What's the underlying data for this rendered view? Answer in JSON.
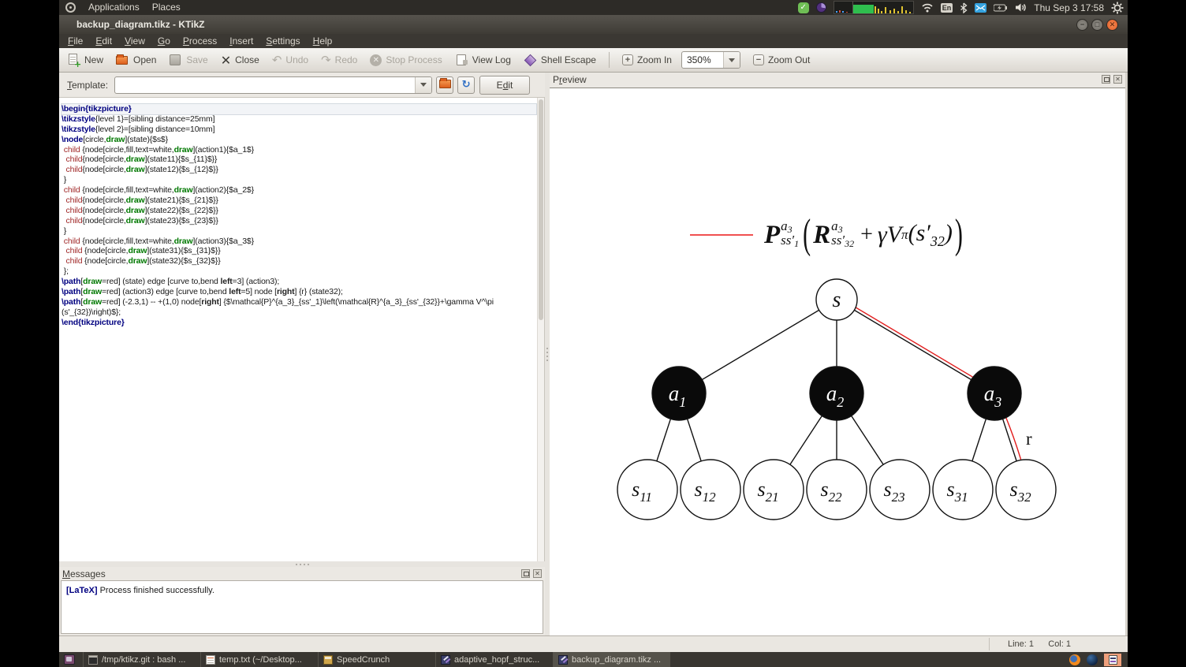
{
  "panel": {
    "menus": [
      {
        "label": "Applications"
      },
      {
        "label": "Places"
      }
    ],
    "keyboard_layout": "En",
    "clock": "Thu Sep 3 17:58"
  },
  "window": {
    "title": "backup_diagram.tikz - KTikZ"
  },
  "menubar": {
    "items": [
      {
        "label": "File"
      },
      {
        "label": "Edit"
      },
      {
        "label": "View"
      },
      {
        "label": "Go"
      },
      {
        "label": "Process"
      },
      {
        "label": "Insert"
      },
      {
        "label": "Settings"
      },
      {
        "label": "Help"
      }
    ]
  },
  "toolbar": {
    "buttons": [
      {
        "label": "New",
        "enabled": true
      },
      {
        "label": "Open",
        "enabled": true
      },
      {
        "label": "Save",
        "enabled": false
      },
      {
        "label": "Close",
        "enabled": true
      },
      {
        "label": "Undo",
        "enabled": false
      },
      {
        "label": "Redo",
        "enabled": false
      },
      {
        "label": "Stop Process",
        "enabled": false
      },
      {
        "label": "View Log",
        "enabled": true
      },
      {
        "label": "Shell Escape",
        "enabled": true
      },
      {
        "label": "Zoom In",
        "enabled": true
      },
      {
        "label": "Zoom Out",
        "enabled": true
      }
    ],
    "zoom_level": "350%"
  },
  "template_bar": {
    "label": "Template:",
    "value": "",
    "edit_button": "Edit"
  },
  "editor": {
    "current_line": 0,
    "lines": [
      {
        "seg": [
          {
            "t": "\\begin{tikzpicture}",
            "c": "k"
          }
        ]
      },
      {
        "seg": [
          {
            "t": "\\tikzstyle",
            "c": "k"
          },
          {
            "t": "{level 1}=[sibling distance=25mm]",
            "c": "p"
          }
        ]
      },
      {
        "seg": [
          {
            "t": "\\tikzstyle",
            "c": "k"
          },
          {
            "t": "{level 2}=[sibling distance=10mm]",
            "c": "p"
          }
        ]
      },
      {
        "seg": [
          {
            "t": "\\node",
            "c": "k"
          },
          {
            "t": "[circle,",
            "c": "p"
          },
          {
            "t": "draw",
            "c": "g"
          },
          {
            "t": "](state){$s$}",
            "c": "p"
          }
        ]
      },
      {
        "seg": [
          {
            "t": " ",
            "c": "p"
          },
          {
            "t": "child",
            "c": "c"
          },
          {
            "t": " {node[circle,fill,text=white,",
            "c": "p"
          },
          {
            "t": "draw",
            "c": "g"
          },
          {
            "t": "](action1){$a_1$}",
            "c": "p"
          }
        ]
      },
      {
        "seg": [
          {
            "t": "  ",
            "c": "p"
          },
          {
            "t": "child",
            "c": "c"
          },
          {
            "t": "{node[circle,",
            "c": "p"
          },
          {
            "t": "draw",
            "c": "g"
          },
          {
            "t": "](state11){$s_{11}$}}",
            "c": "p"
          }
        ]
      },
      {
        "seg": [
          {
            "t": "  ",
            "c": "p"
          },
          {
            "t": "child",
            "c": "c"
          },
          {
            "t": "{node[circle,",
            "c": "p"
          },
          {
            "t": "draw",
            "c": "g"
          },
          {
            "t": "](state12){$s_{12}$}}",
            "c": "p"
          }
        ]
      },
      {
        "seg": [
          {
            "t": " }",
            "c": "p"
          }
        ]
      },
      {
        "seg": [
          {
            "t": " ",
            "c": "p"
          },
          {
            "t": "child",
            "c": "c"
          },
          {
            "t": " {node[circle,fill,text=white,",
            "c": "p"
          },
          {
            "t": "draw",
            "c": "g"
          },
          {
            "t": "](action2){$a_2$}",
            "c": "p"
          }
        ]
      },
      {
        "seg": [
          {
            "t": "  ",
            "c": "p"
          },
          {
            "t": "child",
            "c": "c"
          },
          {
            "t": "{node[circle,",
            "c": "p"
          },
          {
            "t": "draw",
            "c": "g"
          },
          {
            "t": "](state21){$s_{21}$}}",
            "c": "p"
          }
        ]
      },
      {
        "seg": [
          {
            "t": "  ",
            "c": "p"
          },
          {
            "t": "child",
            "c": "c"
          },
          {
            "t": "{node[circle,",
            "c": "p"
          },
          {
            "t": "draw",
            "c": "g"
          },
          {
            "t": "](state22){$s_{22}$}}",
            "c": "p"
          }
        ]
      },
      {
        "seg": [
          {
            "t": "  ",
            "c": "p"
          },
          {
            "t": "child",
            "c": "c"
          },
          {
            "t": "{node[circle,",
            "c": "p"
          },
          {
            "t": "draw",
            "c": "g"
          },
          {
            "t": "](state23){$s_{23}$}}",
            "c": "p"
          }
        ]
      },
      {
        "seg": [
          {
            "t": " }",
            "c": "p"
          }
        ]
      },
      {
        "seg": [
          {
            "t": " ",
            "c": "p"
          },
          {
            "t": "child",
            "c": "c"
          },
          {
            "t": " {node[circle,fill,text=white,",
            "c": "p"
          },
          {
            "t": "draw",
            "c": "g"
          },
          {
            "t": "](action3){$a_3$}",
            "c": "p"
          }
        ]
      },
      {
        "seg": [
          {
            "t": "  ",
            "c": "p"
          },
          {
            "t": "child",
            "c": "c"
          },
          {
            "t": " {node[circle,",
            "c": "p"
          },
          {
            "t": "draw",
            "c": "g"
          },
          {
            "t": "](state31){$s_{31}$}}",
            "c": "p"
          }
        ]
      },
      {
        "seg": [
          {
            "t": "  ",
            "c": "p"
          },
          {
            "t": "child",
            "c": "c"
          },
          {
            "t": " {node[circle,",
            "c": "p"
          },
          {
            "t": "draw",
            "c": "g"
          },
          {
            "t": "](state32){$s_{32}$}}",
            "c": "p"
          }
        ]
      },
      {
        "seg": [
          {
            "t": " };",
            "c": "p"
          }
        ]
      },
      {
        "seg": [
          {
            "t": "\\path",
            "c": "k"
          },
          {
            "t": "[",
            "c": "p"
          },
          {
            "t": "draw",
            "c": "g"
          },
          {
            "t": "=red] (state) edge [curve to,bend ",
            "c": "p"
          },
          {
            "t": "left",
            "c": "o"
          },
          {
            "t": "=3] (action3);",
            "c": "p"
          }
        ]
      },
      {
        "seg": [
          {
            "t": "\\path",
            "c": "k"
          },
          {
            "t": "[",
            "c": "p"
          },
          {
            "t": "draw",
            "c": "g"
          },
          {
            "t": "=red] (action3) edge [curve to,bend ",
            "c": "p"
          },
          {
            "t": "left",
            "c": "o"
          },
          {
            "t": "=5] node [",
            "c": "p"
          },
          {
            "t": "right",
            "c": "o"
          },
          {
            "t": "] {r} (state32);",
            "c": "p"
          }
        ]
      },
      {
        "seg": [
          {
            "t": "\\path",
            "c": "k"
          },
          {
            "t": "[",
            "c": "p"
          },
          {
            "t": "draw",
            "c": "g"
          },
          {
            "t": "=red] (-2.3,1) -- +(1,0) node[",
            "c": "p"
          },
          {
            "t": "right",
            "c": "o"
          },
          {
            "t": "] {$\\mathcal{P}^{a_3}_{ss'_1}\\left(\\mathcal{R}^{a_3}_{ss'_{32}}+\\gamma V^\\pi",
            "c": "p"
          }
        ]
      },
      {
        "seg": [
          {
            "t": "(s'_{32})\\right)$};",
            "c": "p"
          }
        ]
      },
      {
        "seg": [
          {
            "t": "\\end{tikzpicture}",
            "c": "k"
          }
        ]
      }
    ]
  },
  "preview": {
    "title": "Preview",
    "accent_red": "#e21d1d",
    "formula": {
      "P": "P",
      "P_sup_base": "a",
      "P_sup_idx": "3",
      "P_sub_base": "ss′",
      "P_sub_idx": "1",
      "open": "(",
      "R": "R",
      "R_sup_base": "a",
      "R_sup_idx": "3",
      "R_sub_base": "ss′",
      "R_sub_idx": "32",
      "plus": "+",
      "gammaV": "γV",
      "pi": "π",
      "arg": "(s′",
      "arg_idx": "32",
      "arg_close": ")",
      "close": ")"
    },
    "tree": {
      "root": "s",
      "actions": [
        {
          "base": "a",
          "sub": "1"
        },
        {
          "base": "a",
          "sub": "2"
        },
        {
          "base": "a",
          "sub": "3"
        }
      ],
      "states": [
        {
          "base": "s",
          "sub": "11"
        },
        {
          "base": "s",
          "sub": "12"
        },
        {
          "base": "s",
          "sub": "21"
        },
        {
          "base": "s",
          "sub": "22"
        },
        {
          "base": "s",
          "sub": "23"
        },
        {
          "base": "s",
          "sub": "31"
        },
        {
          "base": "s",
          "sub": "32"
        }
      ],
      "reward": "r"
    }
  },
  "messages": {
    "title": "Messages",
    "entries": [
      {
        "tag": "[LaTeX]",
        "text": "Process finished successfully."
      }
    ]
  },
  "statusbar": {
    "line": "Line: 1",
    "col": "Col: 1"
  },
  "taskbar": {
    "items": [
      {
        "label": "/tmp/ktikz.git : bash ...",
        "icon": "terminal-icon",
        "active": false
      },
      {
        "label": "temp.txt (~/Desktop...",
        "icon": "text-file-icon",
        "active": false
      },
      {
        "label": "SpeedCrunch",
        "icon": "calculator-icon",
        "active": false
      },
      {
        "label": "adaptive_hopf_struc...",
        "icon": "ktikz-icon",
        "active": false
      },
      {
        "label": "backup_diagram.tikz ...",
        "icon": "ktikz-icon",
        "active": true
      }
    ]
  }
}
